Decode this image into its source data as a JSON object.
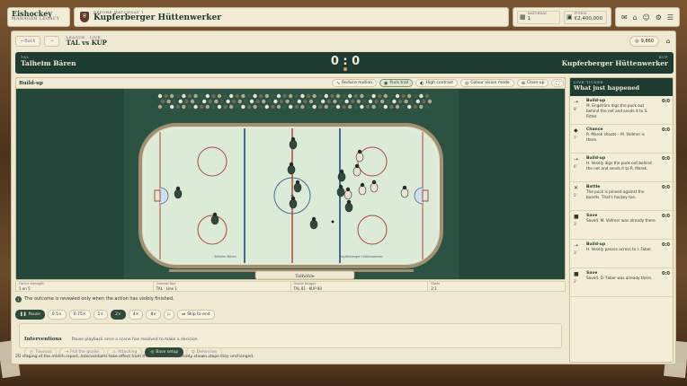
{
  "brand": {
    "name": "Eishockey",
    "subtitle": "MANAGER LEGACY"
  },
  "opponent": {
    "label": "BEFORE MATCHDAY 1",
    "name": "Kupferberger Hüttenwerker"
  },
  "stats": [
    {
      "key": "MATCHDAY",
      "value": "1",
      "icon": "calendar-icon"
    },
    {
      "key": "FUNDS",
      "value": "€2,400,000",
      "icon": "wallet-icon"
    }
  ],
  "header_icons": [
    "inbox-icon",
    "home-icon",
    "people-icon",
    "gear-icon",
    "menu-icon"
  ],
  "subhead": {
    "back_label": "Back",
    "forward_label": "→",
    "league": "LEAGUE · LIVE",
    "match": "TAL vs KUP",
    "coins": "9,860"
  },
  "scoreboard": {
    "home_abbr": "TAL",
    "home_name": "Talheim Bären",
    "score": "0 : 0",
    "away_abbr": "KUP",
    "away_name": "Kupferberger Hüttenwerker"
  },
  "sim": {
    "title": "Build-up",
    "options": [
      {
        "label": "Reduce motion",
        "icon": "motion-icon",
        "on": false
      },
      {
        "label": "Puck trail",
        "icon": "trail-icon",
        "on": true
      },
      {
        "label": "High contrast",
        "icon": "contrast-icon",
        "on": false
      },
      {
        "label": "Colour vision mode",
        "icon": "eye-icon",
        "on": false
      },
      {
        "label": "Close-up",
        "icon": "zoom-icon",
        "on": false
      }
    ],
    "ads_left": "Talheim Bären",
    "ads_right": "Kupferberger Hüttenwerker",
    "bench_label": "Talhöhle"
  },
  "info": [
    {
      "key": "On-ice strength",
      "value": "5 on 5"
    },
    {
      "key": "Current line",
      "value": "TAL · Line 1"
    },
    {
      "key": "Goalie fatigue",
      "value": "TAL 81 · KUP 80"
    },
    {
      "key": "Shots",
      "value": "2:1"
    }
  ],
  "notice": "The outcome is revealed only when the action has visibly finished.",
  "controls": {
    "pause": "Pause",
    "speeds": [
      "0.5×",
      "0.75×",
      "1×",
      "2×",
      "4×",
      "8×"
    ],
    "active_speed": "2×",
    "step": "▷",
    "skip": "Skip to end"
  },
  "interventions": {
    "title": "Interventions",
    "subtitle": "Pause playback once a scene has resolved to make a decision.",
    "buttons": [
      {
        "label": "Timeout",
        "on": false
      },
      {
        "label": "Pull the goalie",
        "on": false
      },
      {
        "label": "Attacking",
        "on": false
      },
      {
        "label": "Base setup",
        "on": true
      },
      {
        "label": "Defensive",
        "on": false
      }
    ]
  },
  "footnote": "2D staging of the match report. Interventions take effect from the next minute; already shown steps stay unchanged.",
  "ticker": {
    "label": "LIVE TICKER",
    "title": "What just happened",
    "events": [
      {
        "minute": "8'",
        "type": "Build-up",
        "text": "M. Engström digs the puck out behind the net and sends it to S. Ritter.",
        "score": "0:0",
        "icon": "build-up-icon"
      },
      {
        "minute": "7'",
        "type": "Chance",
        "text": "R. Marek shoots – M. Vollmer is there.",
        "score": "0:0",
        "icon": "chance-icon"
      },
      {
        "minute": "6'",
        "type": "Build-up",
        "text": "H. Vesely digs the puck out behind the net and sends it to R. Marek.",
        "score": "0:0",
        "icon": "build-up-icon"
      },
      {
        "minute": "5'",
        "type": "Battle",
        "text": "The puck is pinned against the boards. That's hockey too.",
        "score": "0:0",
        "icon": "battle-icon"
      },
      {
        "minute": "3'",
        "type": "Save",
        "text": "Saved. M. Vollmer was already there.",
        "score": "0:0",
        "icon": "save-icon"
      },
      {
        "minute": "3'",
        "type": "Build-up",
        "text": "H. Vesely passes across to I. Faber.",
        "score": "0:0",
        "icon": "build-up-icon"
      },
      {
        "minute": "2'",
        "type": "Save",
        "text": "Saved. D. Faber was already there.",
        "score": "0:0",
        "icon": "save-icon"
      }
    ]
  },
  "colors": {
    "accent": "#1f3c33",
    "ice": "#dcebd8",
    "home_jersey": "#2f4a3a",
    "away_jersey": "#e8e3d5",
    "line_red": "#b0443a",
    "line_blue": "#4a6a8a"
  }
}
